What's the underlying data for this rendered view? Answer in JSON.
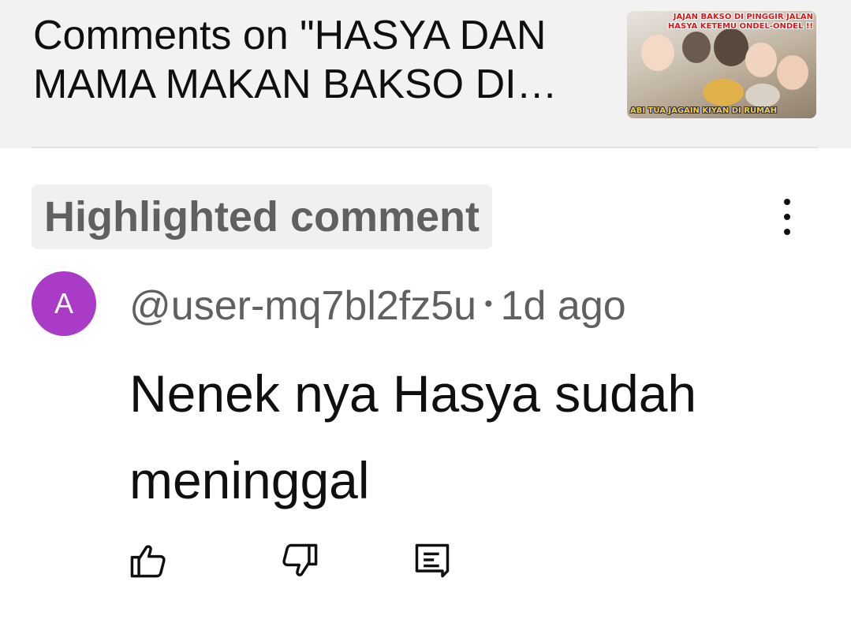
{
  "header": {
    "title": "Comments on \"HASYA DAN MAMA MAKAN BAKSO DI PINGGIR JALAN\"",
    "thumbnail": {
      "caption_top_1": "JAJAN BAKSO DI PINGGIR JALAN",
      "caption_top_2": "HASYA KETEMU ONDEL-ONDEL !!",
      "caption_bottom": "ABI TUA JAGAIN KIYAN DI RUMAH"
    }
  },
  "comment": {
    "badge": "Highlighted comment",
    "avatar_letter": "A",
    "avatar_color": "#a93bc6",
    "author": "@user-mq7bl2fz5u",
    "separator": "•",
    "time": "1d ago",
    "text": "Nenek nya Hasya sudah meninggal"
  },
  "actions": {
    "like_icon": "thumbs-up-icon",
    "dislike_icon": "thumbs-down-icon",
    "reply_icon": "reply-comment-icon",
    "more_icon": "more-vertical-icon"
  }
}
